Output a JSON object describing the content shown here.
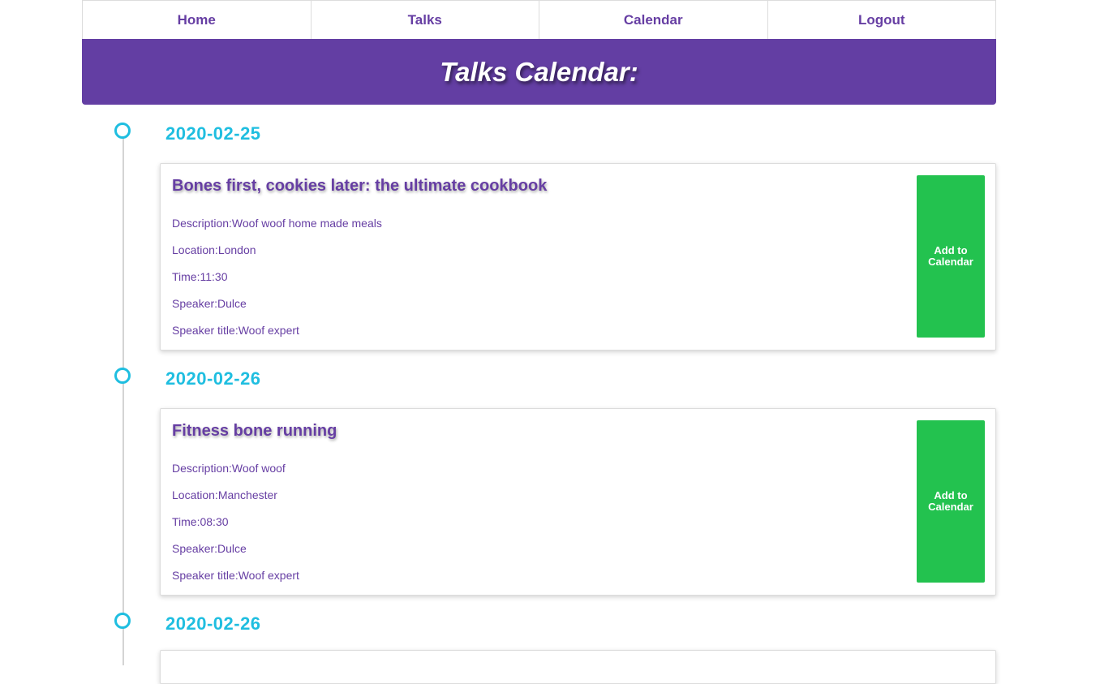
{
  "nav": {
    "items": [
      "Home",
      "Talks",
      "Calendar",
      "Logout"
    ]
  },
  "banner": {
    "title": "Talks Calendar:"
  },
  "talks": [
    {
      "date": "2020-02-25",
      "title": "Bones first, cookies later: the ultimate cookbook",
      "description": "Description:Woof woof home made meals",
      "location": "Location:London",
      "time": "Time:11:30",
      "speaker": "Speaker:Dulce",
      "speaker_title": "Speaker title:Woof expert",
      "button_label": "Add to Calendar"
    },
    {
      "date": "2020-02-26",
      "title": "Fitness bone running",
      "description": "Description:Woof woof",
      "location": "Location:Manchester",
      "time": "Time:08:30",
      "speaker": "Speaker:Dulce",
      "speaker_title": "Speaker title:Woof expert",
      "button_label": "Add to Calendar"
    },
    {
      "date": "2020-02-26"
    }
  ],
  "colors": {
    "nav_text": "#663ea3",
    "banner_bg": "#633ea3",
    "date_accent": "#1fbee0",
    "button_bg": "#23c24f"
  }
}
